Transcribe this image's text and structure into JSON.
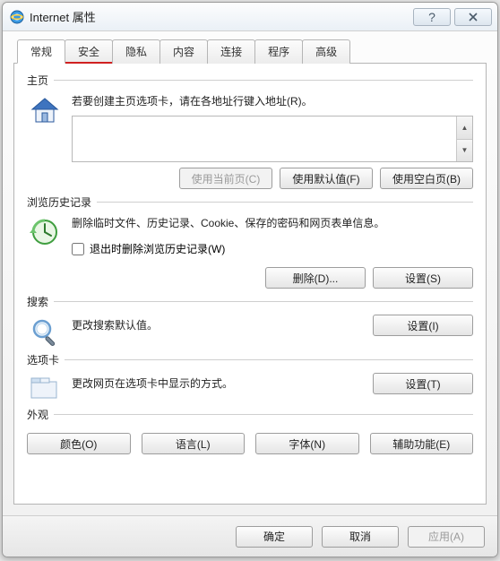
{
  "title": "Internet 属性",
  "tabs": [
    "常规",
    "安全",
    "隐私",
    "内容",
    "连接",
    "程序",
    "高级"
  ],
  "activeTab": 0,
  "homepage": {
    "title": "主页",
    "desc": "若要创建主页选项卡，请在各地址行键入地址(R)。",
    "value": "",
    "btn_current": "使用当前页(C)",
    "btn_default": "使用默认值(F)",
    "btn_blank": "使用空白页(B)"
  },
  "history": {
    "title": "浏览历史记录",
    "desc": "删除临时文件、历史记录、Cookie、保存的密码和网页表单信息。",
    "chk_label": "退出时删除浏览历史记录(W)",
    "chk_checked": false,
    "btn_delete": "删除(D)...",
    "btn_settings": "设置(S)"
  },
  "search": {
    "title": "搜索",
    "desc": "更改搜索默认值。",
    "btn_settings": "设置(I)"
  },
  "tabs_section": {
    "title": "选项卡",
    "desc": "更改网页在选项卡中显示的方式。",
    "btn_settings": "设置(T)"
  },
  "appearance": {
    "title": "外观",
    "btn_colors": "颜色(O)",
    "btn_lang": "语言(L)",
    "btn_fonts": "字体(N)",
    "btn_access": "辅助功能(E)"
  },
  "footer": {
    "ok": "确定",
    "cancel": "取消",
    "apply": "应用(A)"
  }
}
